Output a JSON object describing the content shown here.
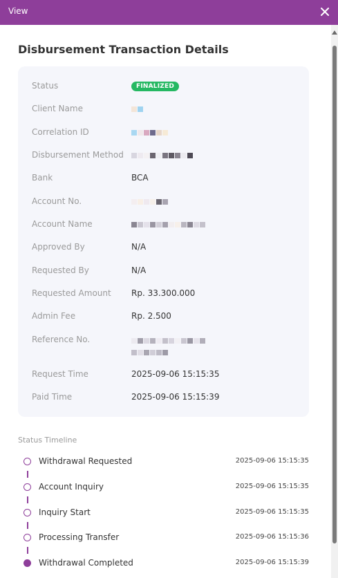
{
  "window": {
    "title": "View"
  },
  "heading": "Disbursement Transaction Details",
  "details": [
    {
      "label": "Status",
      "badge": "FINALIZED"
    },
    {
      "label": "Client Name"
    },
    {
      "label": "Correlation ID"
    },
    {
      "label": "Disbursement Method"
    },
    {
      "label": "Bank",
      "value": "BCA"
    },
    {
      "label": "Account No."
    },
    {
      "label": "Account Name"
    },
    {
      "label": "Approved By",
      "value": "N/A"
    },
    {
      "label": "Requested By",
      "value": "N/A"
    },
    {
      "label": "Requested Amount",
      "value": "Rp. 33.300.000"
    },
    {
      "label": "Admin Fee",
      "value": "Rp. 2.500"
    },
    {
      "label": "Reference No."
    },
    {
      "label": "Request Time",
      "value": "2025-09-06 15:15:35"
    },
    {
      "label": "Paid Time",
      "value": "2025-09-06 15:15:39"
    }
  ],
  "timeline": {
    "label": "Status Timeline",
    "items": [
      {
        "text": "Withdrawal Requested",
        "time": "2025-09-06 15:15:35"
      },
      {
        "text": "Account Inquiry",
        "time": "2025-09-06 15:15:35"
      },
      {
        "text": "Inquiry Start",
        "time": "2025-09-06 15:15:35"
      },
      {
        "text": "Processing Transfer",
        "time": "2025-09-06 15:15:36"
      },
      {
        "text": "Withdrawal Completed",
        "time": "2025-09-06 15:15:39"
      }
    ]
  },
  "colors": {
    "accent": "#8e3e9a",
    "status_success": "#25b862",
    "card_bg": "#f5f6fb"
  },
  "icons": {
    "close": "close-icon",
    "scroll_up": "chevron-up-icon"
  }
}
